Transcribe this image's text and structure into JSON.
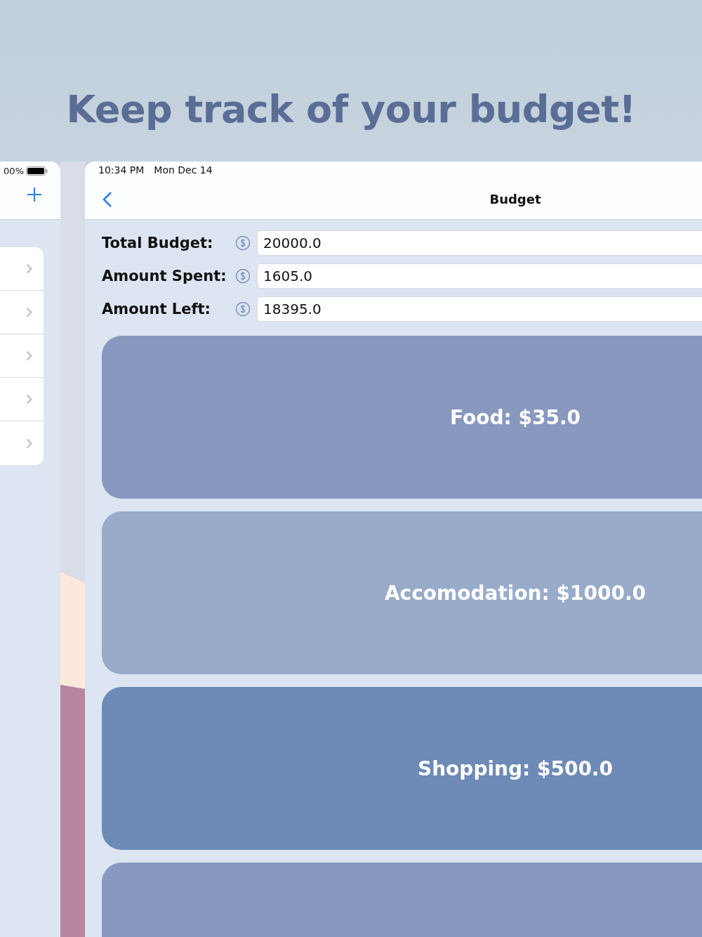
{
  "headline": "Keep track of your budget!",
  "sidebar": {
    "battery_text": "00%",
    "rows": [
      {
        "kind": "chevron"
      },
      {
        "kind": "chevron"
      },
      {
        "kind": "chevron"
      },
      {
        "kind": "chevron"
      },
      {
        "kind": "chevron"
      }
    ]
  },
  "detail": {
    "status_time": "10:34 PM",
    "status_date": "Mon Dec 14",
    "title": "Budget",
    "fields": [
      {
        "label": "Total Budget:",
        "value": "20000.0"
      },
      {
        "label": "Amount Spent:",
        "value": "1605.0"
      },
      {
        "label": "Amount Left:",
        "value": "18395.0"
      }
    ],
    "categories": [
      {
        "label": "Food: $35.0",
        "color": "#8898bf"
      },
      {
        "label": "Accomodation: $1000.0",
        "color": "#98abc9"
      },
      {
        "label": "Shopping: $500.0",
        "color": "#6e8ab6"
      },
      {
        "color": "#8898bf"
      }
    ]
  }
}
